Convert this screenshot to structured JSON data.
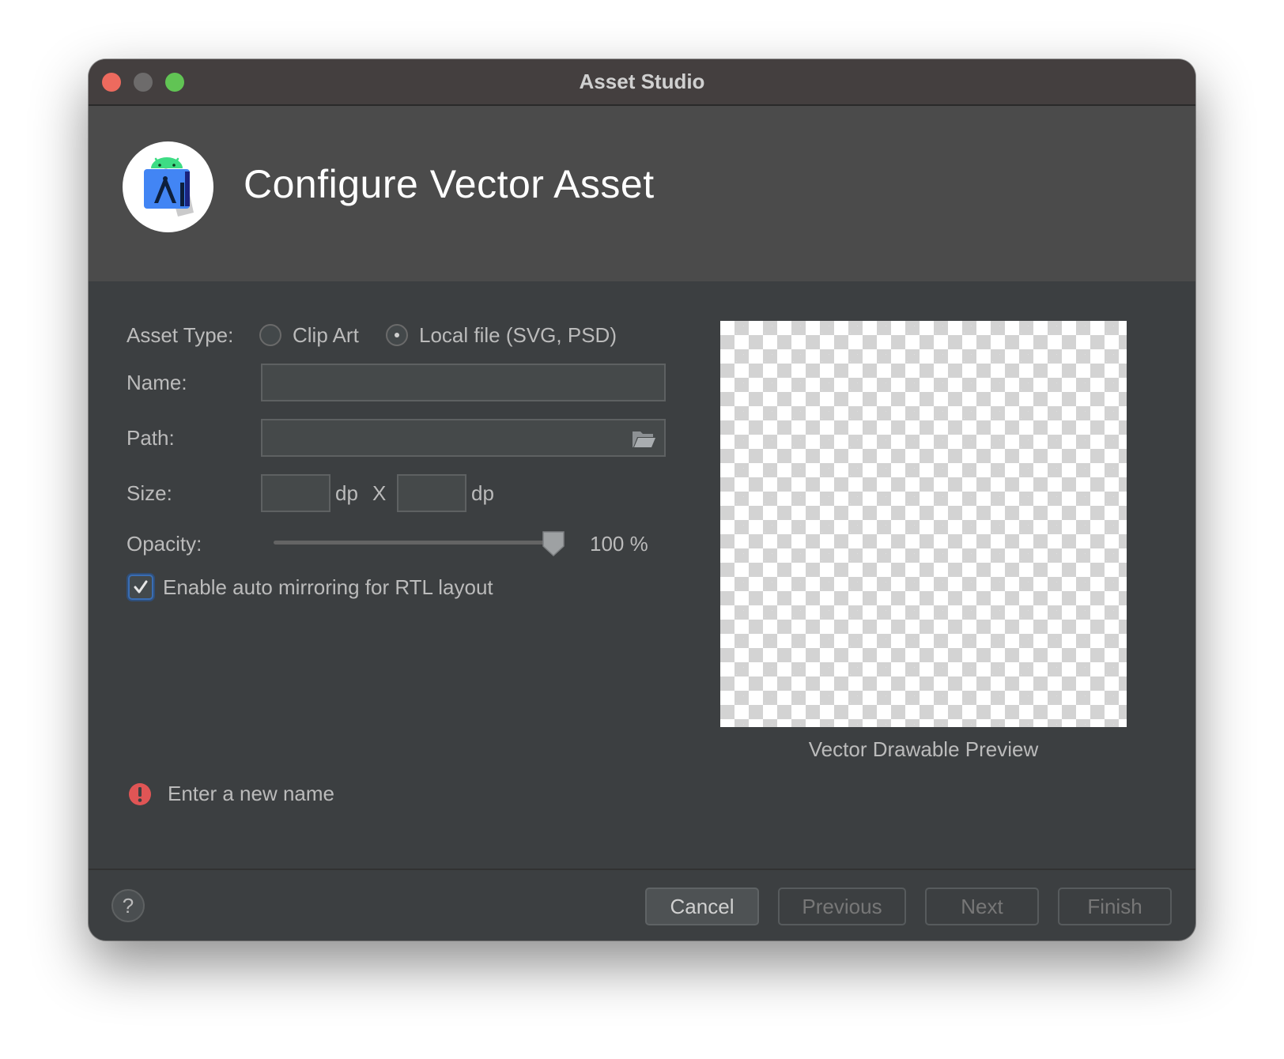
{
  "window": {
    "title": "Asset Studio"
  },
  "header": {
    "title": "Configure Vector Asset",
    "logo_icon": "android-studio-logo-icon"
  },
  "form": {
    "asset_type_label": "Asset Type:",
    "asset_type_options": [
      {
        "label": "Clip Art",
        "selected": false
      },
      {
        "label": "Local file (SVG, PSD)",
        "selected": true
      }
    ],
    "name_label": "Name:",
    "name_value": "",
    "path_label": "Path:",
    "path_value": "",
    "path_browse_icon": "folder-open-icon",
    "size_label": "Size:",
    "size_width_value": "",
    "size_height_value": "",
    "size_unit_width": "dp",
    "size_separator": "X",
    "size_unit_height": "dp",
    "opacity_label": "Opacity:",
    "opacity_value_text": "100 %",
    "opacity_fraction": 1.0,
    "auto_mirror_label": "Enable auto mirroring for RTL layout",
    "auto_mirror_checked": true
  },
  "preview": {
    "caption": "Vector Drawable Preview"
  },
  "validation": {
    "message": "Enter a new name",
    "icon": "error-icon"
  },
  "footer": {
    "help_label": "?",
    "cancel_label": "Cancel",
    "previous_label": "Previous",
    "next_label": "Next",
    "finish_label": "Finish"
  },
  "colors": {
    "titlebar": "#443f3f",
    "header_bg": "#4b4b4b",
    "body_bg": "#3c3f41",
    "close": "#ed6a5e",
    "minimize": "#6d6b6b",
    "zoom": "#61c454",
    "error": "#e05555",
    "accent": "#3a6db3"
  }
}
